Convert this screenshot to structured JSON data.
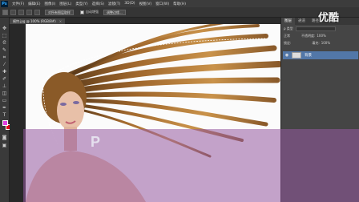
{
  "app": {
    "logo_text": "Ps"
  },
  "menu": [
    "文件(F)",
    "编辑(E)",
    "图像(I)",
    "图层(L)",
    "类型(Y)",
    "选择(S)",
    "滤镜(T)",
    "3D(D)",
    "视图(V)",
    "窗口(W)",
    "帮助(H)"
  ],
  "options_bar": {
    "button_1": "对所有图层取样",
    "check_label": "自动增强",
    "button_2": "调整边缘..."
  },
  "document_tab": {
    "title": "模特.jpg @ 100% (RGB/8#)",
    "close": "×"
  },
  "panel": {
    "tabs": [
      "图层",
      "通道",
      "路径"
    ],
    "kind_label": "ρ 类型",
    "mode": "正常",
    "opacity_label": "不透明度:",
    "opacity_value": "100%",
    "lock_label": "锁定:",
    "fill_label": "填充:",
    "fill_value": "100%",
    "layer_name": "背景"
  },
  "watermark": {
    "text": "优酷"
  },
  "overlay": {
    "logo_letter": "P"
  },
  "colors": {
    "foreground": "#e13fe0",
    "background": "#e2001a",
    "overlay": "#965aa0",
    "layer_highlight": "#5277a8"
  }
}
